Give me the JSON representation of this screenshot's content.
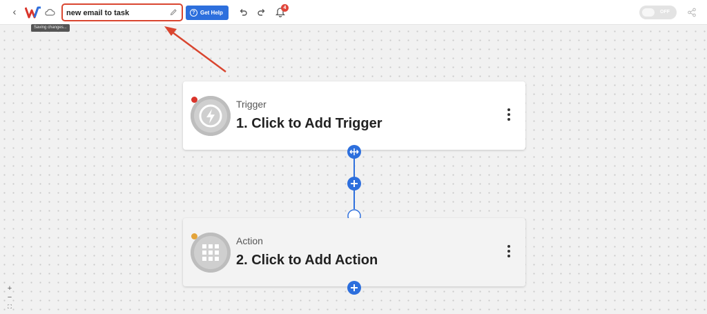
{
  "header": {
    "workflow_name": "new email to task",
    "saving_status": "Saving changes...",
    "help_label": "Get Help",
    "help_icon": "?",
    "notification_count": "4",
    "toggle_label": "OFF"
  },
  "steps": {
    "trigger": {
      "kind": "Trigger",
      "title": "1. Click to Add Trigger",
      "status_color": "#d9342b"
    },
    "action": {
      "kind": "Action",
      "title": "2. Click to Add Action",
      "status_color": "#e4a43a"
    }
  },
  "zoom": {
    "in": "+",
    "out": "−",
    "fit": "⛶"
  },
  "colors": {
    "accent": "#2d6fdd",
    "annotation": "#d9452f"
  },
  "icons": [
    "back-chevron-icon",
    "app-logo-icon",
    "cloud-icon",
    "pencil-icon",
    "help-icon",
    "undo-icon",
    "redo-icon",
    "bell-icon",
    "share-icon",
    "bolt-icon",
    "grid-icon",
    "plus-icon",
    "kebab-menu-icon"
  ]
}
